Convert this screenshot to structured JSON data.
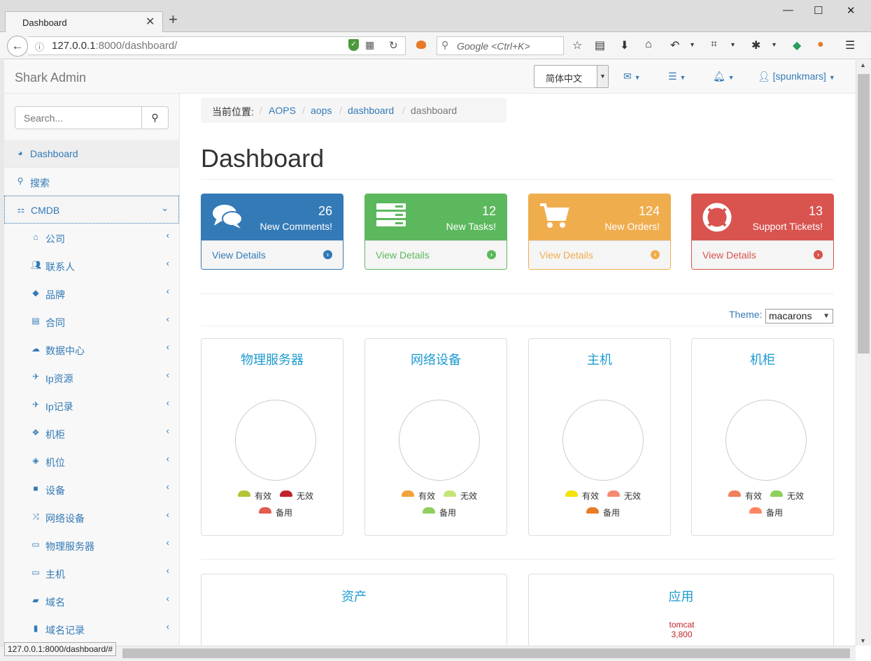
{
  "browser": {
    "tab_title": "Dashboard",
    "url_host": "127.0.0.1",
    "url_rest": ":8000/dashboard/",
    "search_placeholder": "Google <Ctrl+K>",
    "status_url": "127.0.0.1:8000/dashboard/#"
  },
  "topnav": {
    "brand": "Shark Admin",
    "language": "简体中文",
    "user": "[spunkmars]"
  },
  "sidebar": {
    "search_placeholder": "Search...",
    "items": [
      {
        "label": "Dashboard",
        "icon": "dashboard-icon"
      },
      {
        "label": "搜索",
        "icon": "search-icon"
      },
      {
        "label": "CMDB",
        "icon": "sitemap-icon"
      },
      {
        "label": "公司",
        "icon": "bank-icon"
      },
      {
        "label": "联系人",
        "icon": "users-icon"
      },
      {
        "label": "品牌",
        "icon": "tags-icon"
      },
      {
        "label": "合同",
        "icon": "file-icon"
      },
      {
        "label": "数据中心",
        "icon": "cloud-icon"
      },
      {
        "label": "Ip资源",
        "icon": "plane-icon"
      },
      {
        "label": "Ip记录",
        "icon": "plane-icon"
      },
      {
        "label": "机柜",
        "icon": "cubes-icon"
      },
      {
        "label": "机位",
        "icon": "cube-icon"
      },
      {
        "label": "设备",
        "icon": "stop-icon"
      },
      {
        "label": "网络设备",
        "icon": "random-icon"
      },
      {
        "label": "物理服务器",
        "icon": "desktop-icon"
      },
      {
        "label": "主机",
        "icon": "laptop-icon"
      },
      {
        "label": "域名",
        "icon": "book-icon"
      },
      {
        "label": "域名记录",
        "icon": "bookmark-icon"
      }
    ]
  },
  "breadcrumb": {
    "prefix": "当前位置:",
    "items": [
      "AOPS",
      "aops",
      "dashboard",
      "dashboard"
    ]
  },
  "page_title": "Dashboard",
  "panels": [
    {
      "count": "26",
      "label": "New Comments!",
      "link": "View Details",
      "color": "#337ab7",
      "icon": "comments-icon"
    },
    {
      "count": "12",
      "label": "New Tasks!",
      "link": "View Details",
      "color": "#5cb85c",
      "icon": "tasks-icon"
    },
    {
      "count": "124",
      "label": "New Orders!",
      "link": "View Details",
      "color": "#f0ad4e",
      "icon": "shopping-cart-icon"
    },
    {
      "count": "13",
      "label": "Support Tickets!",
      "link": "View Details",
      "color": "#d9534f",
      "icon": "support-icon"
    }
  ],
  "theme": {
    "label": "Theme:",
    "value": "macarons"
  },
  "status_charts": [
    {
      "title": "物理服务器",
      "legend": [
        {
          "name": "有效",
          "color": "#b5c334"
        },
        {
          "name": "无效",
          "color": "#c1232b"
        },
        {
          "name": "备用",
          "color": "#e05c4e"
        }
      ]
    },
    {
      "title": "网络设备",
      "legend": [
        {
          "name": "有效",
          "color": "#f0a33a"
        },
        {
          "name": "无效",
          "color": "#c6e579"
        },
        {
          "name": "备用",
          "color": "#8fcf5b"
        }
      ]
    },
    {
      "title": "主机",
      "legend": [
        {
          "name": "有效",
          "color": "#f5e307"
        },
        {
          "name": "无效",
          "color": "#f58a73"
        },
        {
          "name": "备用",
          "color": "#e87c25"
        }
      ]
    },
    {
      "title": "机柜",
      "legend": [
        {
          "name": "有效",
          "color": "#f0805a"
        },
        {
          "name": "无效",
          "color": "#8fcf5b"
        },
        {
          "name": "备用",
          "color": "#fe8463"
        }
      ]
    }
  ],
  "bottom_cards": [
    {
      "title": "资产"
    },
    {
      "title": "应用",
      "label_name": "tomcat",
      "label_value": "3,800"
    }
  ]
}
